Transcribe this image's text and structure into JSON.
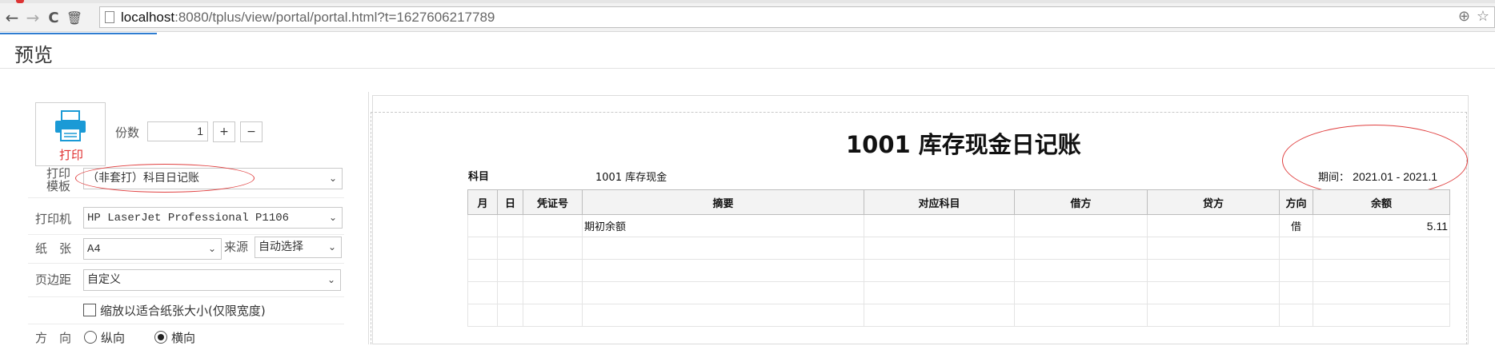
{
  "browser": {
    "url_host": "localhost",
    "url_rest": ":8080/tplus/view/portal/portal.html?t=1627606217789",
    "back_icon": "←",
    "forward_icon": "→",
    "reload_icon": "C",
    "delete_icon": "🗑",
    "zoom_icon": "⊕",
    "star_icon": "☆"
  },
  "dialog": {
    "title": "预览"
  },
  "settings": {
    "print_label": "打印",
    "copies_label": "份数",
    "copies_value": "1",
    "plus_label": "+",
    "minus_label": "−",
    "template_label_1": "打印",
    "template_label_2": "模板",
    "template_value": "（非套打）科目日记账",
    "printer_label": "打印机",
    "printer_value": "HP LaserJet Professional P1106",
    "paper_label": "纸　张",
    "paper_value": "A4",
    "source_label": "来源",
    "source_value": "自动选择",
    "margin_label": "页边距",
    "margin_value": "自定义",
    "fit_label": "缩放以适合纸张大小(仅限宽度)",
    "orientation_label": "方　向",
    "portrait_label": "纵向",
    "landscape_label": "横向",
    "selected_orientation": "横向",
    "caret": "⌄"
  },
  "report": {
    "title": "1001 库存现金日记账",
    "subject_label": "科目",
    "subject_value": "1001 库存现金",
    "period_label": "期间：",
    "period_value": "2021.01 - 2021.1",
    "columns": [
      "月",
      "日",
      "凭证号",
      "摘要",
      "对应科目",
      "借方",
      "贷方",
      "方向",
      "余额"
    ],
    "rows": [
      [
        "",
        "",
        "",
        "期初余额",
        "",
        "",
        "",
        "借",
        "5.11"
      ],
      [
        "",
        "",
        "",
        "",
        "",
        "",
        "",
        "",
        ""
      ],
      [
        "",
        "",
        "",
        "",
        "",
        "",
        "",
        "",
        ""
      ],
      [
        "",
        "",
        "",
        "",
        "",
        "",
        "",
        "",
        ""
      ],
      [
        "",
        "",
        "",
        "",
        "",
        "",
        "",
        "",
        ""
      ]
    ]
  },
  "colors": {
    "accent": "#2f7dd1",
    "print_red": "#e03030",
    "annotation": "#e04040",
    "printer_blue": "#1a9ad6"
  }
}
